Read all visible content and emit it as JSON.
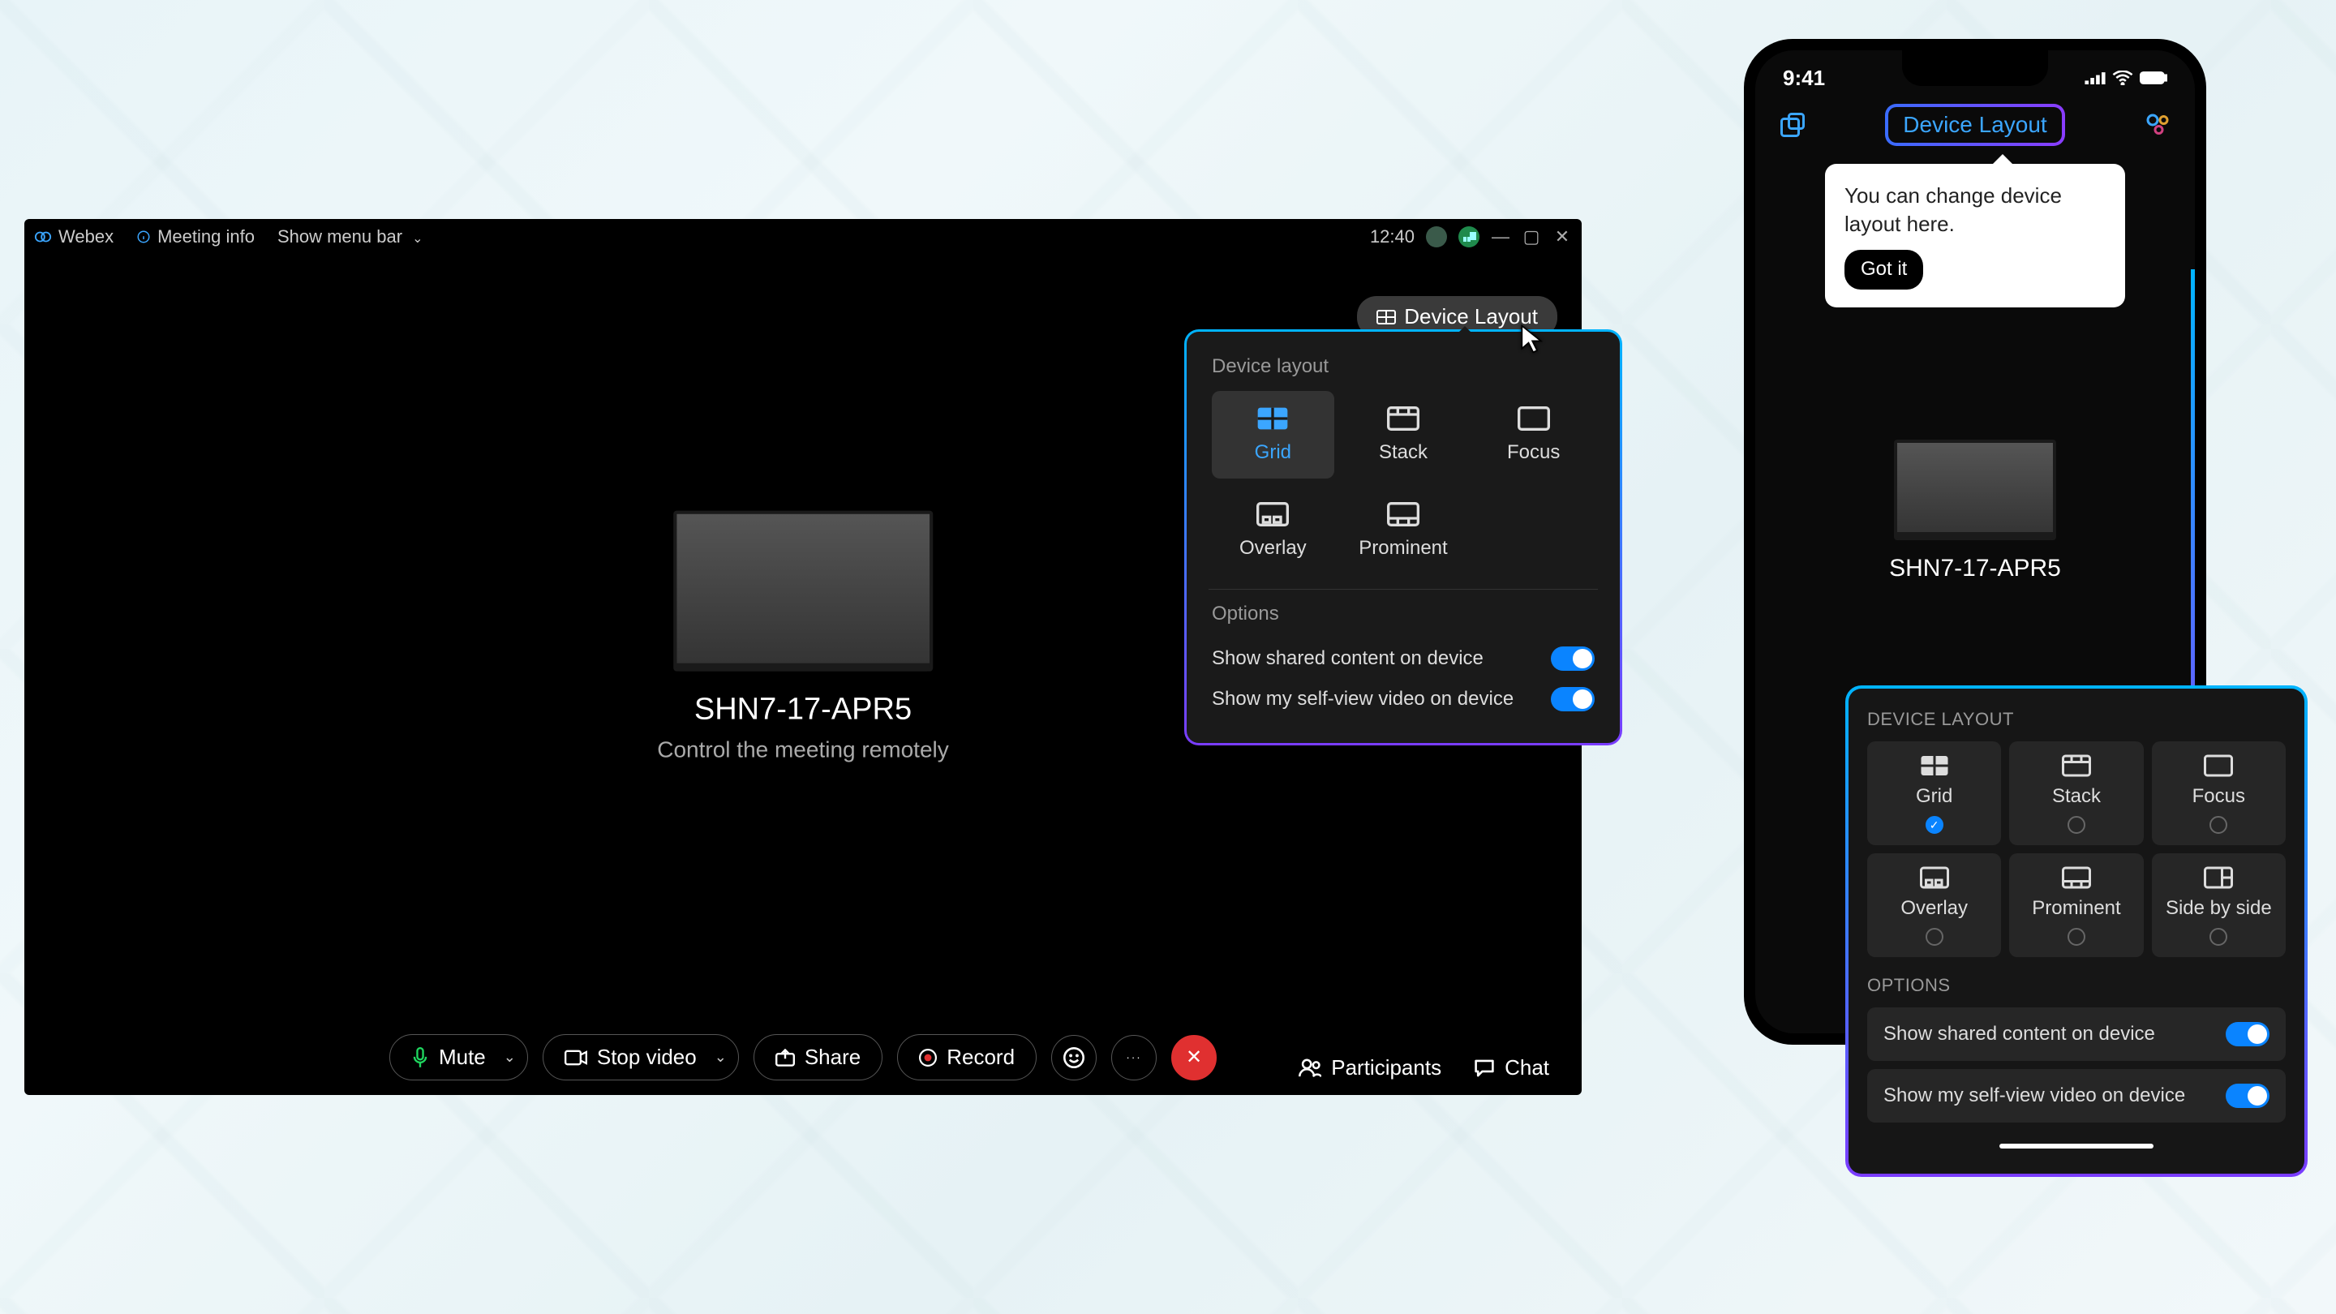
{
  "desktop": {
    "titlebar": {
      "brand": "Webex",
      "meeting_info": "Meeting info",
      "show_menu": "Show menu bar",
      "time": "12:40"
    },
    "device_layout_button": "Device Layout",
    "center": {
      "device_name": "SHN7-17-APR5",
      "subtitle": "Control the meeting remotely"
    },
    "popover": {
      "title": "Device layout",
      "layouts": [
        "Grid",
        "Stack",
        "Focus",
        "Overlay",
        "Prominent"
      ],
      "selected": "Grid",
      "options_header": "Options",
      "opt_shared": "Show shared content on device",
      "opt_selfview": "Show my self-view video on device"
    },
    "controls": {
      "mute": "Mute",
      "stop_video": "Stop video",
      "share": "Share",
      "record": "Record",
      "participants": "Participants",
      "chat": "Chat"
    }
  },
  "mobile": {
    "time": "9:41",
    "nav_button": "Device Layout",
    "tooltip": {
      "text": "You can change device layout here.",
      "button": "Got it"
    },
    "device_name": "SHN7-17-APR5"
  },
  "mpanel": {
    "title": "DEVICE LAYOUT",
    "layouts": [
      "Grid",
      "Stack",
      "Focus",
      "Overlay",
      "Prominent",
      "Side by side"
    ],
    "selected": "Grid",
    "options_header": "OPTIONS",
    "opt_shared": "Show shared content on device",
    "opt_selfview": "Show my self-view video on device"
  }
}
